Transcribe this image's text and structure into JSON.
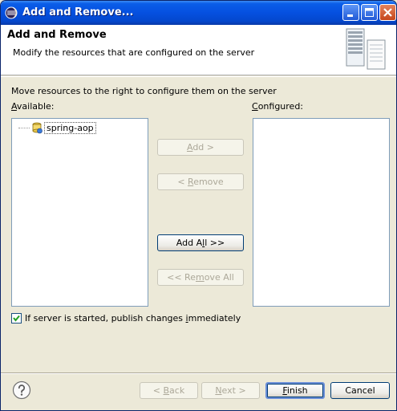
{
  "window": {
    "title": "Add and Remove...",
    "title_color": "#0550e0"
  },
  "header": {
    "title": "Add and Remove",
    "description": "Modify the resources that are configured on the server",
    "icon": "server-icon"
  },
  "body": {
    "instruction": "Move resources to the right to configure them on the server",
    "available_label_pre": "",
    "available_label_mn": "A",
    "available_label_post": "vailable:",
    "configured_label_pre": "",
    "configured_label_mn": "C",
    "configured_label_post": "onfigured:",
    "available_items": [
      {
        "label": "spring-aop",
        "icon": "web-module-icon"
      }
    ],
    "configured_items": []
  },
  "buttons": {
    "add": {
      "pre": "",
      "mn": "A",
      "post": "dd >",
      "enabled": false
    },
    "remove": {
      "pre": "< ",
      "mn": "R",
      "post": "emove",
      "enabled": false
    },
    "add_all": {
      "pre": "Add A",
      "mn": "l",
      "post": "l >>",
      "enabled": true
    },
    "remove_all": {
      "pre": "<< Re",
      "mn": "m",
      "post": "ove All",
      "enabled": false
    }
  },
  "publish_option": {
    "checked": true,
    "pre": "If server is started, publish changes ",
    "mn": "i",
    "post": "mmediately"
  },
  "footer": {
    "back": {
      "pre": "< ",
      "mn": "B",
      "post": "ack",
      "enabled": false
    },
    "next": {
      "pre": "",
      "mn": "N",
      "post": "ext >",
      "enabled": false
    },
    "finish": {
      "pre": "",
      "mn": "F",
      "post": "inish",
      "enabled": true
    },
    "cancel": {
      "label": "Cancel",
      "enabled": true
    },
    "help_icon": "help-icon"
  }
}
